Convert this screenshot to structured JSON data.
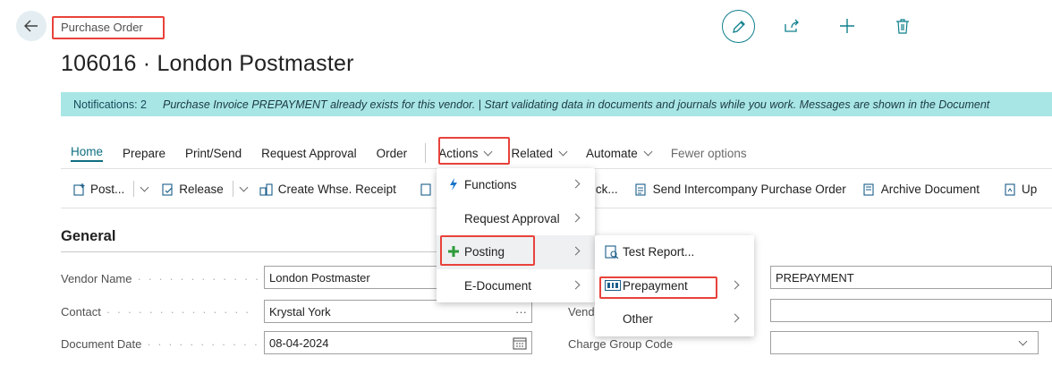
{
  "header": {
    "breadcrumb": "Purchase Order",
    "title": "106016 · London Postmaster",
    "actions": [
      "edit-icon",
      "share-icon",
      "add-icon",
      "delete-icon"
    ]
  },
  "notification": {
    "count_label": "Notifications: 2",
    "message": "Purchase Invoice PREPAYMENT already exists for this vendor. |  Start validating data in documents and journals while you work. Messages are shown in the Document"
  },
  "action_bar": {
    "home": "Home",
    "prepare": "Prepare",
    "print_send": "Print/Send",
    "request_approval": "Request Approval",
    "order": "Order",
    "actions": "Actions",
    "related": "Related",
    "automate": "Automate",
    "fewer_options": "Fewer options"
  },
  "command_bar": {
    "post": "Post...",
    "release": "Release",
    "create_whse_receipt": "Create Whse. Receipt",
    "partial_ck": "ck...",
    "send_intercompany": "Send Intercompany Purchase Order",
    "archive_document": "Archive Document",
    "partial_up": "Up"
  },
  "actions_menu": {
    "items": [
      "Functions",
      "Request Approval",
      "Posting",
      "E-Document"
    ]
  },
  "posting_menu": {
    "items": [
      "Test Report...",
      "Prepayment",
      "Other"
    ]
  },
  "general": {
    "section_title": "General",
    "vendor_name_label": "Vendor Name",
    "vendor_name_value": "London Postmaster",
    "contact_label": "Contact",
    "contact_value": "Krystal York",
    "contact_more": "···",
    "document_date_label": "Document Date",
    "document_date_value": "08-04-2024",
    "right_field_1_value": "PREPAYMENT",
    "right_label_2": "Vend",
    "charge_group_label": "Charge Group Code",
    "dots": "· · · · · · · · · · · · · ·"
  },
  "colors": {
    "accent": "#0e7f8c",
    "notification_bg": "#a8e6e6",
    "highlight_box": "#e8423a",
    "posting_green": "#2e9b3a",
    "functions_blue": "#1a73c8"
  }
}
